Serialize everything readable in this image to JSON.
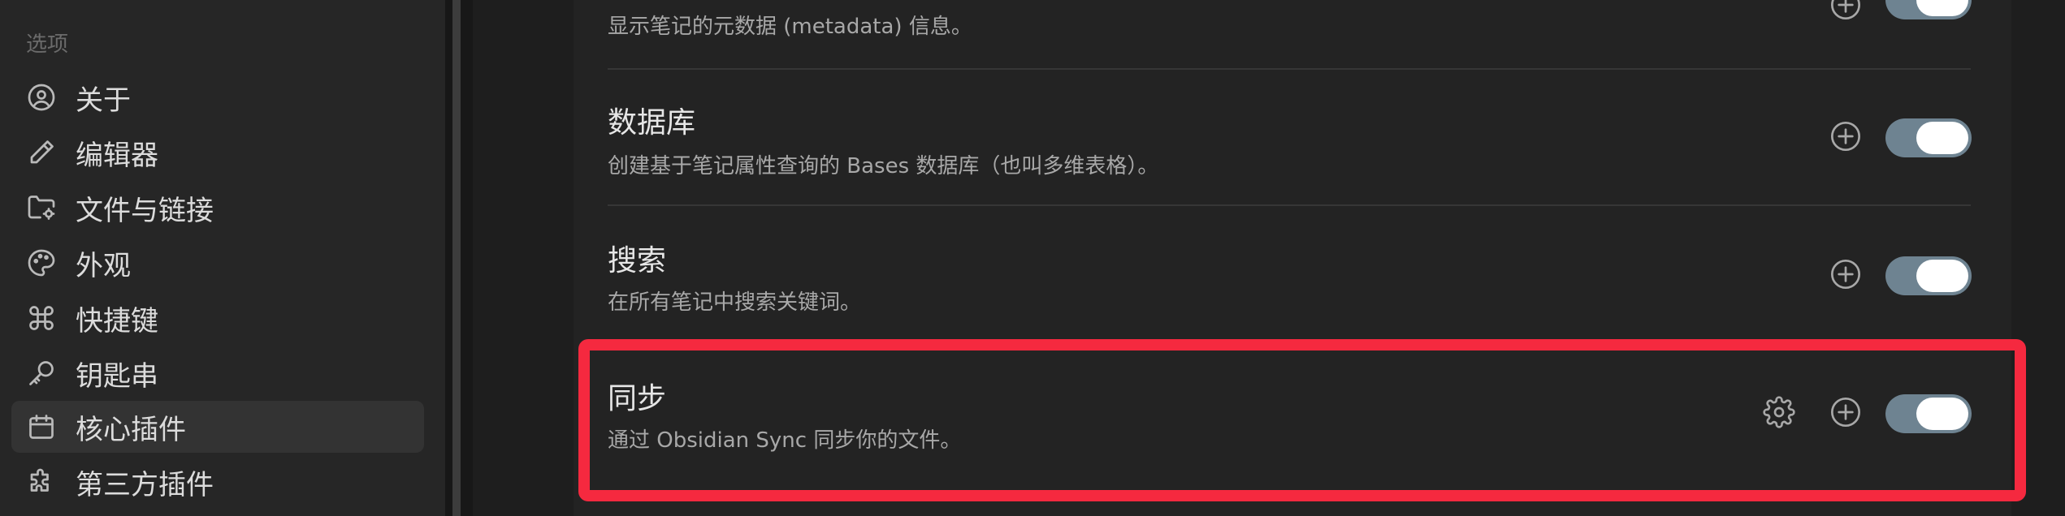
{
  "sidebar": {
    "section_label": "选项",
    "items": [
      {
        "label": "关于",
        "icon": "user-circle-icon"
      },
      {
        "label": "编辑器",
        "icon": "pencil-icon"
      },
      {
        "label": "文件与链接",
        "icon": "folder-cog-icon"
      },
      {
        "label": "外观",
        "icon": "palette-icon"
      },
      {
        "label": "快捷键",
        "icon": "command-icon"
      },
      {
        "label": "钥匙串",
        "icon": "key-icon"
      },
      {
        "label": "核心插件",
        "icon": "calendar-icon"
      },
      {
        "label": "第三方插件",
        "icon": "puzzle-icon"
      }
    ],
    "active_item": "核心插件"
  },
  "plugins": [
    {
      "title": "",
      "description": "显示笔记的元数据 (metadata) 信息。",
      "enabled": true,
      "has_settings": false
    },
    {
      "title": "数据库",
      "description": "创建基于笔记属性查询的 Bases 数据库（也叫多维表格）。",
      "enabled": true,
      "has_settings": false
    },
    {
      "title": "搜索",
      "description": "在所有笔记中搜索关键词。",
      "enabled": true,
      "has_settings": false
    },
    {
      "title": "同步",
      "description": "通过 Obsidian Sync 同步你的文件。",
      "enabled": true,
      "has_settings": true
    }
  ],
  "colors": {
    "toggle_on": "#6e8391",
    "highlight": "#f5293f",
    "background": "#1e1e1e"
  }
}
